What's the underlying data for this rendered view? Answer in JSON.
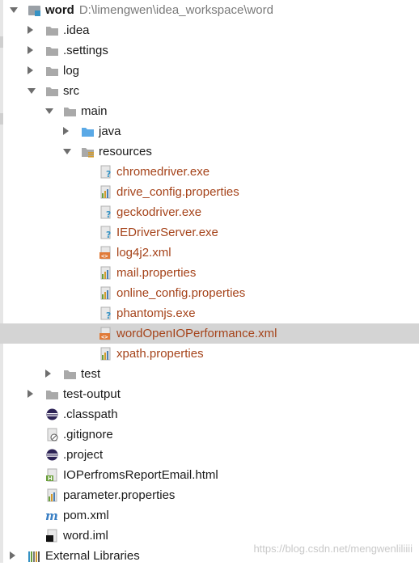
{
  "project": {
    "name": "word",
    "path": "D:\\limengwen\\idea_workspace\\word"
  },
  "tree": [
    {
      "label": "word",
      "kind": "module",
      "expanded": true,
      "indent": 0
    },
    {
      "label": ".idea",
      "kind": "folder",
      "expanded": false,
      "indent": 1
    },
    {
      "label": ".settings",
      "kind": "folder",
      "expanded": false,
      "indent": 1
    },
    {
      "label": "log",
      "kind": "folder",
      "expanded": false,
      "indent": 1
    },
    {
      "label": "src",
      "kind": "folder",
      "expanded": true,
      "indent": 1
    },
    {
      "label": "main",
      "kind": "folder",
      "expanded": true,
      "indent": 2
    },
    {
      "label": "java",
      "kind": "source-folder",
      "expanded": false,
      "indent": 3
    },
    {
      "label": "resources",
      "kind": "resources-folder",
      "expanded": true,
      "indent": 3
    },
    {
      "label": "chromedriver.exe",
      "kind": "exe",
      "indent": 4
    },
    {
      "label": "drive_config.properties",
      "kind": "properties",
      "indent": 4
    },
    {
      "label": "geckodriver.exe",
      "kind": "exe",
      "indent": 4
    },
    {
      "label": "IEDriverServer.exe",
      "kind": "exe",
      "indent": 4
    },
    {
      "label": "log4j2.xml",
      "kind": "xml",
      "indent": 4
    },
    {
      "label": "mail.properties",
      "kind": "properties",
      "indent": 4
    },
    {
      "label": "online_config.properties",
      "kind": "properties",
      "indent": 4
    },
    {
      "label": "phantomjs.exe",
      "kind": "exe",
      "indent": 4
    },
    {
      "label": "wordOpenIOPerformance.xml",
      "kind": "xml",
      "indent": 4,
      "selected": true
    },
    {
      "label": "xpath.properties",
      "kind": "properties",
      "indent": 4
    },
    {
      "label": "test",
      "kind": "folder",
      "expanded": false,
      "indent": 2
    },
    {
      "label": "test-output",
      "kind": "folder",
      "expanded": false,
      "indent": 1
    },
    {
      "label": ".classpath",
      "kind": "eclipse",
      "indent": 1
    },
    {
      "label": ".gitignore",
      "kind": "gitignore",
      "indent": 1
    },
    {
      "label": ".project",
      "kind": "eclipse",
      "indent": 1
    },
    {
      "label": "IOPerfromsReportEmail.html",
      "kind": "html",
      "indent": 1
    },
    {
      "label": "parameter.properties",
      "kind": "properties",
      "indent": 1
    },
    {
      "label": "pom.xml",
      "kind": "maven",
      "indent": 1
    },
    {
      "label": "word.iml",
      "kind": "iml",
      "indent": 1
    },
    {
      "label": "External Libraries",
      "kind": "libraries",
      "expanded": false,
      "indent": 0
    }
  ],
  "watermark": "https://blog.csdn.net/mengwenliliiii",
  "colors": {
    "selection": "#d4d4d4",
    "resource_text": "#a5431a",
    "folder": "#a9a9a9",
    "source_folder": "#5aa9e6"
  }
}
